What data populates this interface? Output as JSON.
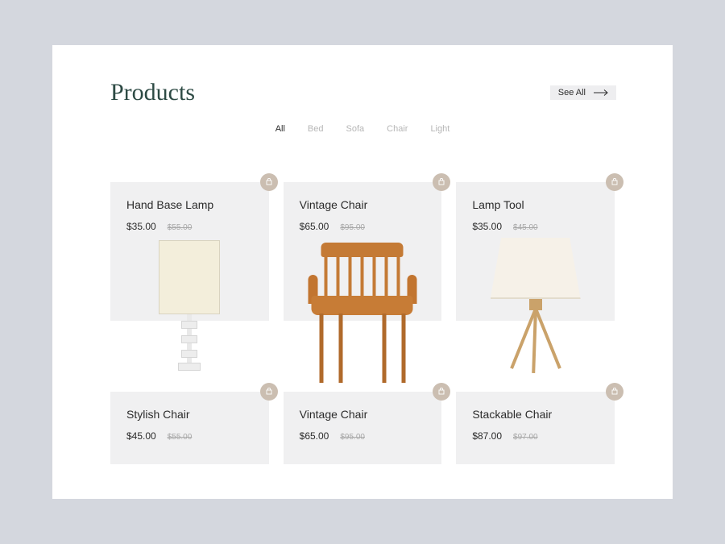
{
  "header": {
    "title": "Products",
    "see_all_label": "See All"
  },
  "tabs": [
    {
      "label": "All",
      "active": true
    },
    {
      "label": "Bed",
      "active": false
    },
    {
      "label": "Sofa",
      "active": false
    },
    {
      "label": "Chair",
      "active": false
    },
    {
      "label": "Light",
      "active": false
    }
  ],
  "products": [
    {
      "name": "Hand Base Lamp",
      "price": "$35.00",
      "old_price": "$55.00"
    },
    {
      "name": "Vintage Chair",
      "price": "$65.00",
      "old_price": "$95.00"
    },
    {
      "name": "Lamp Tool",
      "price": "$35.00",
      "old_price": "$45.00"
    },
    {
      "name": "Stylish Chair",
      "price": "$45.00",
      "old_price": "$55.00"
    },
    {
      "name": "Vintage Chair",
      "price": "$65.00",
      "old_price": "$95.00"
    },
    {
      "name": "Stackable Chair",
      "price": "$87.00",
      "old_price": "$97.00"
    }
  ]
}
